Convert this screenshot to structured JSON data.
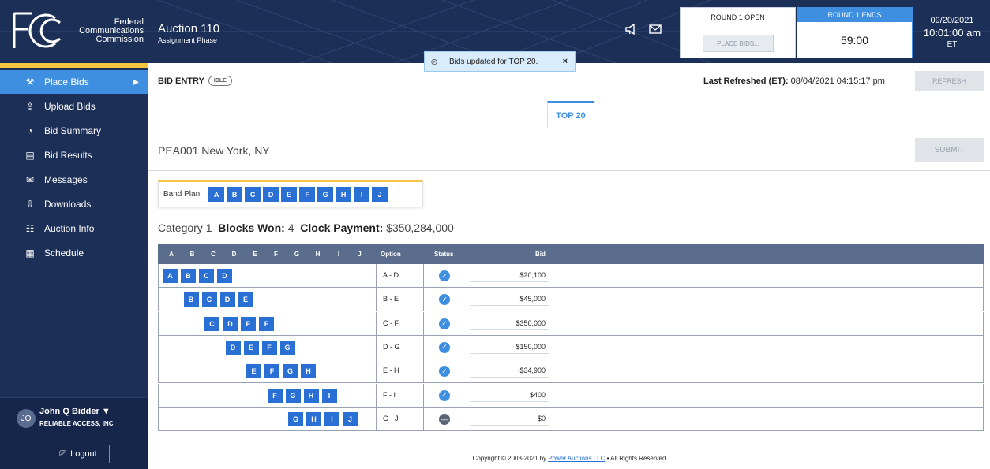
{
  "header": {
    "org_line1": "Federal",
    "org_line2": "Communications",
    "org_line3": "Commission",
    "auction_title": "Auction 110",
    "auction_phase": "Assignment Phase",
    "round_open_label": "ROUND 1 OPEN",
    "place_bids_button": "PLACE BIDS...",
    "round_ends_label": "ROUND 1 ENDS",
    "timer": "59:00",
    "date": "09/20/2021",
    "time": "10:01:00 am",
    "timezone": "ET"
  },
  "toast": {
    "message": "Bids updated for TOP 20.",
    "close": "×"
  },
  "sidebar": {
    "items": [
      {
        "label": "Place Bids",
        "icon": "gavel-icon"
      },
      {
        "label": "Upload Bids",
        "icon": "upload-icon"
      },
      {
        "label": "Bid Summary",
        "icon": "summary-icon"
      },
      {
        "label": "Bid Results",
        "icon": "results-icon"
      },
      {
        "label": "Messages",
        "icon": "envelope-icon"
      },
      {
        "label": "Downloads",
        "icon": "download-icon"
      },
      {
        "label": "Auction Info",
        "icon": "clipboard-icon"
      },
      {
        "label": "Schedule",
        "icon": "calendar-icon"
      }
    ],
    "user": {
      "initials": "JQ",
      "name": "John Q Bidder",
      "org": "RELIABLE ACCESS, INC",
      "logout": "Logout"
    }
  },
  "main": {
    "bid_entry_label": "BID ENTRY",
    "status_badge": "IDLE",
    "last_refreshed_label": "Last Refreshed (ET):",
    "last_refreshed_value": "08/04/2021 04:15:17 pm",
    "refresh_button": "REFRESH",
    "tab": "TOP 20",
    "pea_code": "PEA001",
    "pea_name": "New York, NY",
    "submit_button": "SUBMIT",
    "band_plan_label": "Band Plan",
    "band_blocks": [
      "A",
      "B",
      "C",
      "D",
      "E",
      "F",
      "G",
      "H",
      "I",
      "J"
    ],
    "category_label": "Category 1",
    "blocks_won_label": "Blocks Won:",
    "blocks_won_value": "4",
    "clock_payment_label": "Clock Payment:",
    "clock_payment_value": "$350,284,000"
  },
  "table": {
    "header_letters": [
      "A",
      "B",
      "C",
      "D",
      "E",
      "F",
      "G",
      "H",
      "I",
      "J"
    ],
    "col_option": "Option",
    "col_status": "Status",
    "col_bid": "Bid",
    "rows": [
      {
        "blocks": [
          "A",
          "B",
          "C",
          "D"
        ],
        "option": "A - D",
        "status": "check",
        "bid": "$20,100"
      },
      {
        "blocks": [
          "B",
          "C",
          "D",
          "E"
        ],
        "option": "B - E",
        "status": "check",
        "bid": "$45,000"
      },
      {
        "blocks": [
          "C",
          "D",
          "E",
          "F"
        ],
        "option": "C - F",
        "status": "check",
        "bid": "$350,000"
      },
      {
        "blocks": [
          "D",
          "E",
          "F",
          "G"
        ],
        "option": "D - G",
        "status": "check",
        "bid": "$150,000"
      },
      {
        "blocks": [
          "E",
          "F",
          "G",
          "H"
        ],
        "option": "E - H",
        "status": "check",
        "bid": "$34,900"
      },
      {
        "blocks": [
          "F",
          "G",
          "H",
          "I"
        ],
        "option": "F - I",
        "status": "check",
        "bid": "$400"
      },
      {
        "blocks": [
          "G",
          "H",
          "I",
          "J"
        ],
        "option": "G - J",
        "status": "none",
        "bid": "$0"
      }
    ]
  },
  "footer": {
    "prefix": "Copyright © 2003-2021 by ",
    "link": "Power Auctions LLC",
    "suffix": " • All Rights Reserved"
  }
}
